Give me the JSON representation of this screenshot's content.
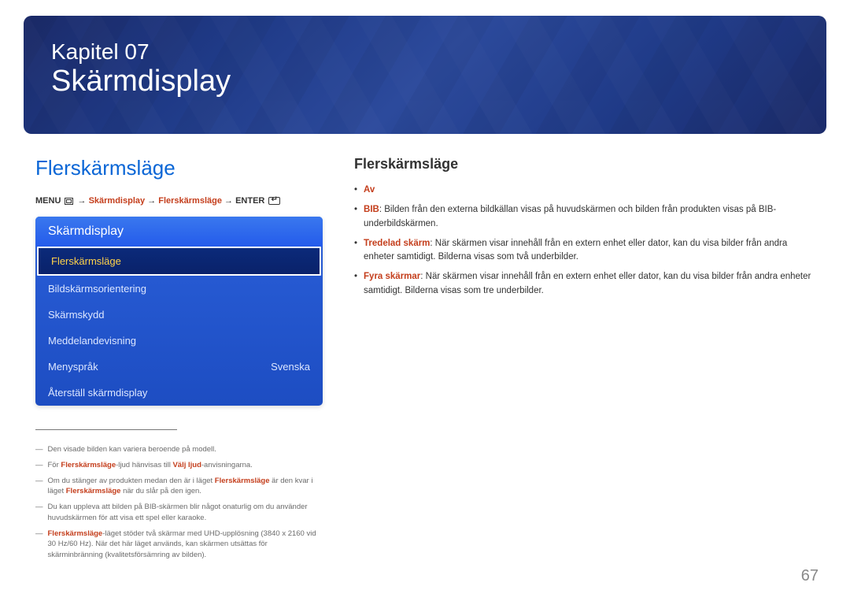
{
  "hero": {
    "chapter": "Kapitel 07",
    "title": "Skärmdisplay"
  },
  "left": {
    "heading": "Flerskärmsläge",
    "breadcrumb": {
      "menu": "MENU",
      "p1": "Skärmdisplay",
      "p2": "Flerskärmsläge",
      "enter": "ENTER",
      "arrow": "→"
    },
    "menu": {
      "title": "Skärmdisplay",
      "items": [
        {
          "label": "Flerskärmsläge",
          "value": "",
          "selected": true
        },
        {
          "label": "Bildskärmsorientering",
          "value": "",
          "selected": false
        },
        {
          "label": "Skärmskydd",
          "value": "",
          "selected": false
        },
        {
          "label": "Meddelandevisning",
          "value": "",
          "selected": false
        },
        {
          "label": "Menyspråk",
          "value": "Svenska",
          "selected": false
        },
        {
          "label": "Återställ skärmdisplay",
          "value": "",
          "selected": false
        }
      ]
    },
    "footnotes": [
      {
        "pre": "Den visade bilden kan variera beroende på modell."
      },
      {
        "pre": "För ",
        "hl1": "Flerskärmsläge",
        "mid": "-ljud hänvisas till ",
        "hl2": "Välj ljud",
        "post": "-anvisningarna."
      },
      {
        "pre": "Om du stänger av produkten medan den är i läget ",
        "hl1": "Flerskärmsläge",
        "mid": " är den kvar i läget ",
        "hl2": "Flerskärmsläge",
        "post": " när du slår på den igen."
      },
      {
        "pre": "Du kan uppleva att bilden på BIB-skärmen blir något onaturlig om du använder huvudskärmen för att visa ett spel eller karaoke."
      },
      {
        "hl1": "Flerskärmsläge",
        "pre2": "-läget stöder två skärmar med UHD-upplösning (3840 x 2160 vid 30 Hz/60 Hz). När det här läget används, kan skärmen utsättas för skärminbränning (kvalitetsförsämring av bilden)."
      }
    ]
  },
  "right": {
    "heading": "Flerskärmsläge",
    "bullets": [
      {
        "hl": "Av",
        "text": ""
      },
      {
        "hl": "BIB",
        "text": ": Bilden från den externa bildkällan visas på huvudskärmen och bilden från produkten visas på BIB-underbildskärmen."
      },
      {
        "hl": "Tredelad skärm",
        "text": ": När skärmen visar innehåll från en extern enhet eller dator, kan du visa bilder från andra enheter samtidigt. Bilderna visas som två underbilder."
      },
      {
        "hl": "Fyra skärmar",
        "text": ": När skärmen visar innehåll från en extern enhet eller dator, kan du visa bilder från andra enheter samtidigt. Bilderna visas som tre underbilder."
      }
    ]
  },
  "pageNumber": "67"
}
